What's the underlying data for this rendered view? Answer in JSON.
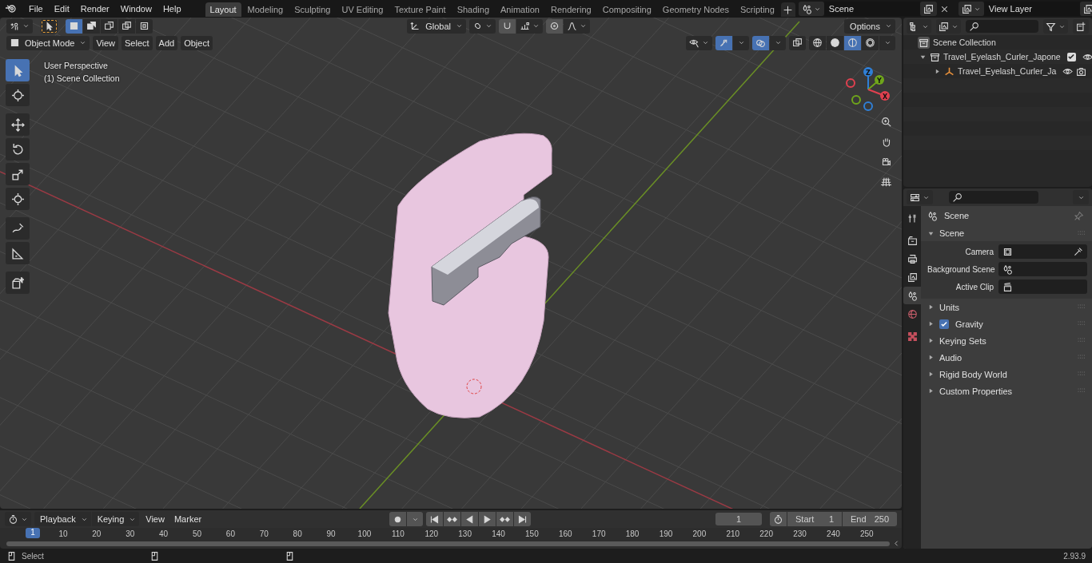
{
  "menus": [
    "File",
    "Edit",
    "Render",
    "Window",
    "Help"
  ],
  "workspace_tabs": [
    {
      "label": "Layout",
      "selected": true
    },
    {
      "label": "Modeling",
      "selected": false
    },
    {
      "label": "Sculpting",
      "selected": false
    },
    {
      "label": "UV Editing",
      "selected": false
    },
    {
      "label": "Texture Paint",
      "selected": false
    },
    {
      "label": "Shading",
      "selected": false
    },
    {
      "label": "Animation",
      "selected": false
    },
    {
      "label": "Rendering",
      "selected": false
    },
    {
      "label": "Compositing",
      "selected": false
    },
    {
      "label": "Geometry Nodes",
      "selected": false
    },
    {
      "label": "Scripting",
      "selected": false
    }
  ],
  "scene_field": {
    "value": "Scene"
  },
  "view_layer_field": {
    "value": "View Layer"
  },
  "viewport": {
    "select_modes": [
      {
        "kind": "set",
        "selected": true
      },
      {
        "kind": "extend",
        "selected": false
      },
      {
        "kind": "subtract",
        "selected": false
      },
      {
        "kind": "invert",
        "selected": false
      },
      {
        "kind": "intersect",
        "selected": false
      }
    ],
    "orientation": "Global",
    "options": "Options",
    "mode": "Object Mode",
    "menus": [
      "View",
      "Select",
      "Add",
      "Object"
    ],
    "toggles": {
      "snap": false,
      "proportional": false,
      "gizmos": true,
      "overlays": true,
      "xray": false
    },
    "shading_modes": [
      {
        "kind": "wireframe",
        "selected": false
      },
      {
        "kind": "solid",
        "selected": false
      },
      {
        "kind": "material",
        "selected": true
      },
      {
        "kind": "rendered",
        "selected": false
      }
    ],
    "overlay_text": [
      "User Perspective",
      "(1) Scene Collection"
    ],
    "tools": [
      {
        "kind": "select",
        "selected": true
      },
      {
        "kind": "cursor",
        "selected": false
      },
      {
        "kind": "move",
        "selected": false
      },
      {
        "kind": "rotate",
        "selected": false
      },
      {
        "kind": "scale",
        "selected": false
      },
      {
        "kind": "transform",
        "selected": false
      },
      {
        "kind": "annotate",
        "selected": false
      },
      {
        "kind": "measure",
        "selected": false
      },
      {
        "kind": "add-cube",
        "selected": false
      }
    ],
    "axes": [
      {
        "label": "Z",
        "color": "#2f7fd6"
      },
      {
        "label": "Y",
        "color": "#6fa51b"
      },
      {
        "label": "X",
        "color": "#e0404f"
      }
    ]
  },
  "outliner": {
    "root": "Scene Collection",
    "items": [
      {
        "label": "Travel_Eyelash_Curler_Japone",
        "kind": "collection",
        "expanded": true,
        "checked": true,
        "children": [
          {
            "label": "Travel_Eyelash_Curler_Ja",
            "kind": "object",
            "expanded": false
          }
        ]
      }
    ]
  },
  "properties": {
    "tabs": [
      {
        "kind": "tool",
        "selected": false
      },
      {
        "kind": "render",
        "selected": false
      },
      {
        "kind": "output",
        "selected": false
      },
      {
        "kind": "view-layer",
        "selected": false
      },
      {
        "kind": "scene",
        "selected": true
      },
      {
        "kind": "world",
        "selected": false
      },
      {
        "kind": "texture",
        "selected": false
      }
    ],
    "context": "Scene",
    "panel": {
      "title": "Scene",
      "expanded": true,
      "fields": [
        {
          "label": "Camera",
          "kind": "camera"
        },
        {
          "label": "Background Scene",
          "kind": "scene"
        },
        {
          "label": "Active Clip",
          "kind": "clip"
        }
      ]
    },
    "sections": [
      {
        "label": "Units",
        "kind": "plain",
        "expanded": false
      },
      {
        "label": "Gravity",
        "kind": "checkbox",
        "checked": true,
        "expanded": false
      },
      {
        "label": "Keying Sets",
        "kind": "plain",
        "expanded": false
      },
      {
        "label": "Audio",
        "kind": "plain",
        "expanded": false
      },
      {
        "label": "Rigid Body World",
        "kind": "plain",
        "expanded": false
      },
      {
        "label": "Custom Properties",
        "kind": "plain",
        "expanded": false
      }
    ]
  },
  "timeline": {
    "menus": [
      {
        "label": "Playback",
        "kind": "dropdown"
      },
      {
        "label": "Keying",
        "kind": "dropdown"
      },
      {
        "label": "View",
        "kind": "menu"
      },
      {
        "label": "Marker",
        "kind": "menu"
      }
    ],
    "current_frame": "1",
    "start_label": "Start",
    "start": "1",
    "end_label": "End",
    "end": "250",
    "playhead": "1",
    "ticks": [
      "10",
      "20",
      "30",
      "40",
      "50",
      "60",
      "70",
      "80",
      "90",
      "100",
      "110",
      "120",
      "130",
      "140",
      "150",
      "160",
      "170",
      "180",
      "190",
      "200",
      "210",
      "220",
      "230",
      "240",
      "250"
    ]
  },
  "status_bar": {
    "action": "Select",
    "version": "2.93.9"
  }
}
